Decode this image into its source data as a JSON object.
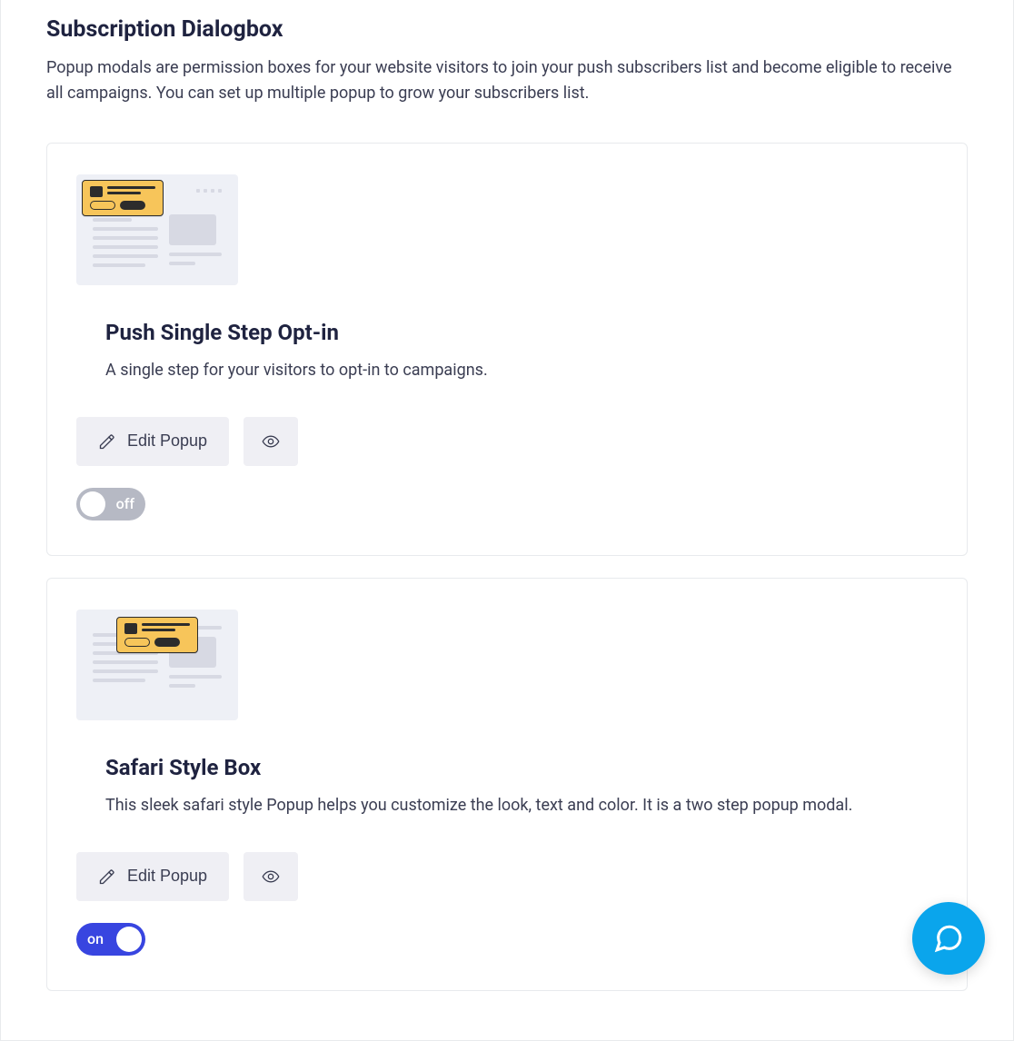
{
  "header": {
    "title": "Subscription Dialogbox",
    "description": "Popup modals are permission boxes for your website visitors to join your push subscribers list and become eligible to receive all campaigns. You can set up multiple popup to grow your subscribers list."
  },
  "cards": [
    {
      "title": "Push Single Step Opt-in",
      "description": "A single step for your visitors to opt-in to campaigns.",
      "edit_label": "Edit Popup",
      "toggle_state": "off",
      "toggle_label": "off",
      "thumb_style": "top-left"
    },
    {
      "title": "Safari Style Box",
      "description": "This sleek safari style Popup helps you customize the look, text and color. It is a two step popup modal.",
      "edit_label": "Edit Popup",
      "toggle_state": "on",
      "toggle_label": "on",
      "thumb_style": "top-center"
    }
  ],
  "icons": {
    "edit": "pencil-icon",
    "preview": "eye-icon",
    "chat": "chat-icon"
  }
}
